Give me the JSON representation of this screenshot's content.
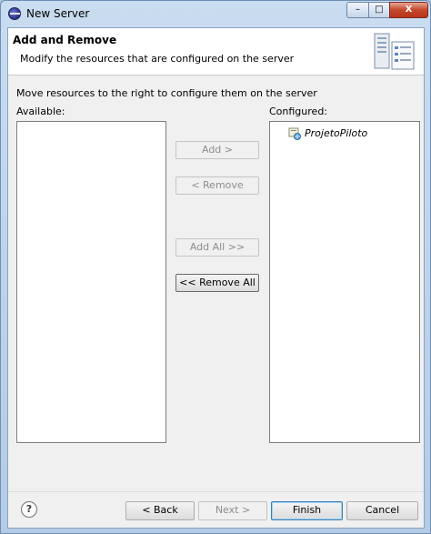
{
  "window": {
    "title": "New Server",
    "controls": {
      "minimize": "–",
      "maximize": "□",
      "close": "X"
    }
  },
  "header": {
    "title": "Add and Remove",
    "description": "Modify the resources that are configured on the server",
    "icon": "server-icon"
  },
  "main": {
    "instruction": "Move resources to the right to configure them on the server",
    "available_label": "Available:",
    "configured_label": "Configured:",
    "available_items": [],
    "configured_items": [
      {
        "label": "ProjetoPiloto",
        "icon": "web-project-icon"
      }
    ]
  },
  "buttons": {
    "add": "Add >",
    "remove": "< Remove",
    "add_all": "Add All >>",
    "remove_all": "<< Remove All"
  },
  "footer": {
    "help": "?",
    "back": "< Back",
    "next": "Next >",
    "finish": "Finish",
    "cancel": "Cancel"
  }
}
